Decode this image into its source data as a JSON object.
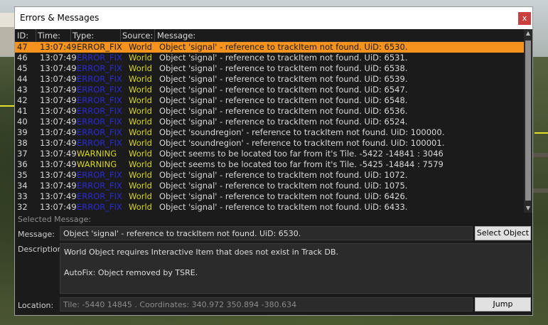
{
  "window": {
    "title": "Errors & Messages",
    "close_label": "x"
  },
  "table": {
    "columns": [
      "ID:",
      "Time:",
      "Type:",
      "Source:",
      "Message:"
    ],
    "rows": [
      {
        "id": "47",
        "time": "13:07:49",
        "type": "ERROR_FIX",
        "source": "World",
        "message": "Object 'signal' - reference to trackItem not found. UiD: 6530."
      },
      {
        "id": "46",
        "time": "13:07:49",
        "type": "ERROR_FIX",
        "source": "World",
        "message": "Object 'signal' - reference to trackItem not found. UiD: 6531."
      },
      {
        "id": "45",
        "time": "13:07:49",
        "type": "ERROR_FIX",
        "source": "World",
        "message": "Object 'signal' - reference to trackItem not found. UiD: 6538."
      },
      {
        "id": "44",
        "time": "13:07:49",
        "type": "ERROR_FIX",
        "source": "World",
        "message": "Object 'signal' - reference to trackItem not found. UiD: 6539."
      },
      {
        "id": "43",
        "time": "13:07:49",
        "type": "ERROR_FIX",
        "source": "World",
        "message": "Object 'signal' - reference to trackItem not found. UiD: 6547."
      },
      {
        "id": "42",
        "time": "13:07:49",
        "type": "ERROR_FIX",
        "source": "World",
        "message": "Object 'signal' - reference to trackItem not found. UiD: 6548."
      },
      {
        "id": "41",
        "time": "13:07:49",
        "type": "ERROR_FIX",
        "source": "World",
        "message": "Object 'signal' - reference to trackItem not found. UiD: 6536."
      },
      {
        "id": "40",
        "time": "13:07:49",
        "type": "ERROR_FIX",
        "source": "World",
        "message": "Object 'signal' - reference to trackItem not found. UiD: 6524."
      },
      {
        "id": "39",
        "time": "13:07:49",
        "type": "ERROR_FIX",
        "source": "World",
        "message": "Object 'soundregion' - reference to trackItem not found. UiD: 100000."
      },
      {
        "id": "38",
        "time": "13:07:49",
        "type": "ERROR_FIX",
        "source": "World",
        "message": "Object 'soundregion' - reference to trackItem not found. UiD: 100001."
      },
      {
        "id": "37",
        "time": "13:07:49",
        "type": "WARNING",
        "source": "World",
        "message": "Object seems to be located too far from it's Tile. -5422 -14841 : 3046"
      },
      {
        "id": "36",
        "time": "13:07:49",
        "type": "WARNING",
        "source": "World",
        "message": "Object seems to be located too far from it's Tile. -5425 -14844 : 7579"
      },
      {
        "id": "35",
        "time": "13:07:49",
        "type": "ERROR_FIX",
        "source": "World",
        "message": "Object 'signal' - reference to trackItem not found. UiD: 1072."
      },
      {
        "id": "34",
        "time": "13:07:49",
        "type": "ERROR_FIX",
        "source": "World",
        "message": "Object 'signal' - reference to trackItem not found. UiD: 1075."
      },
      {
        "id": "33",
        "time": "13:07:49",
        "type": "ERROR_FIX",
        "source": "World",
        "message": "Object 'signal' - reference to trackItem not found. UiD: 6426."
      },
      {
        "id": "32",
        "time": "13:07:49",
        "type": "ERROR_FIX",
        "source": "World",
        "message": "Object 'signal' - reference to trackItem not found. UiD: 6433."
      }
    ]
  },
  "selected": {
    "section_label": "Selected Message:",
    "message_label": "Message:",
    "message_value": "Object 'signal' - reference to trackItem not found. UiD: 6530.",
    "select_object_label": "Select Object",
    "description_label": "Description:",
    "description_line1": "World Object requires Interactive Item that does not exist in Track DB.",
    "description_line2": "AutoFix: Object removed by TSRE.",
    "location_label": "Location:",
    "location_value": "Tile: -5440 14845 . Coordinates: 340.972 350.894 -380.634",
    "jump_label": "Jump"
  },
  "colors": {
    "selected_row": "#f6921e",
    "error_fix": "#2a2ad6",
    "warning": "#d7d72a",
    "source": "#d7d72a"
  }
}
